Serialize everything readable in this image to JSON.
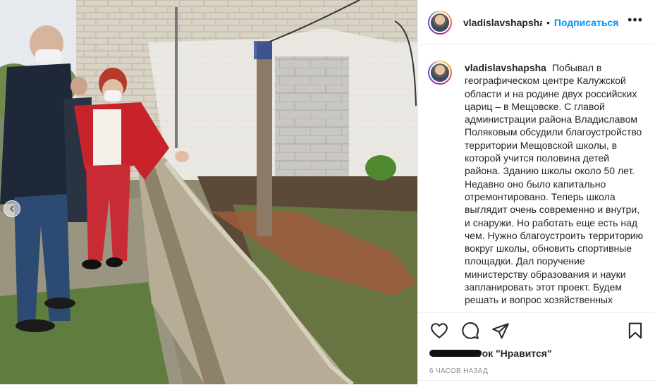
{
  "header": {
    "username": "vladislavshapsha",
    "separator": "•",
    "follow_label": "Подписаться",
    "more_label": "•••"
  },
  "caption": {
    "username": "vladislavshapsha",
    "text": "Побывал в географическом центре Калужской области и на родине двух российских цариц – в Мещовске. С главой администрации района Владиславом Поляковым обсудили благоустройство территории Мещовской школы, в которой учится половина детей района. Зданию школы около 50 лет. Недавно оно было капитально отремонтировано. Теперь школа выглядит очень современно и внутри, и снаружи. Но работать еще есть над чем. Нужно благоустроить территорию вокруг школы, обновить спортивные площадки. Дал поручение министерству образования и науки запланировать этот проект. Будем решать и вопрос хозяйственных"
  },
  "likes": {
    "suffix": "ток \"Нравится\""
  },
  "timestamp": "6 часов назад",
  "photo": {
    "description_icon": "photo"
  },
  "colors": {
    "accent": "#0095f6",
    "text": "#262626",
    "muted": "#8e8e8e",
    "border": "#efefef"
  }
}
